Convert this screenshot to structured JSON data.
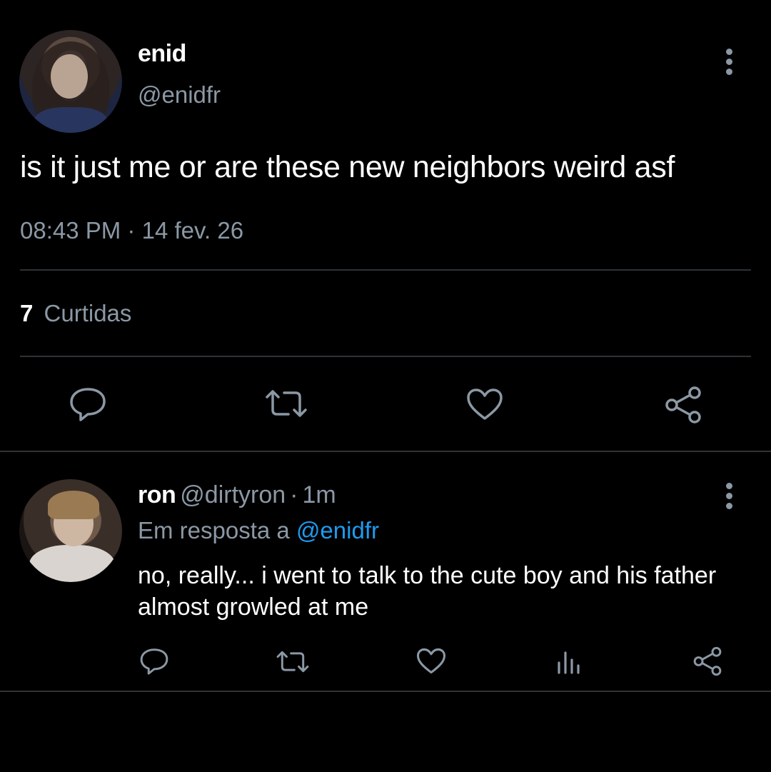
{
  "main_tweet": {
    "author": {
      "name": "enid",
      "handle": "@enidfr"
    },
    "text": "is it just me or are these new neighbors weird asf",
    "time": "08:43 PM",
    "separator": "·",
    "date": "14 fev. 26",
    "likes_count": "7",
    "likes_label": "Curtidas",
    "actions": [
      "reply-icon",
      "retweet-icon",
      "heart-icon",
      "share-icon"
    ]
  },
  "reply": {
    "author": {
      "name": "ron",
      "handle": "@dirtyron"
    },
    "separator": "·",
    "time": "1m",
    "reply_to_label": "Em resposta a",
    "reply_to_handle": "@enidfr",
    "text": "no, really... i went to talk to the cute boy and his father almost growled at me",
    "actions": [
      "reply-icon",
      "retweet-icon",
      "heart-icon",
      "analytics-icon",
      "share-icon"
    ]
  },
  "colors": {
    "background": "#000000",
    "text": "#ffffff",
    "secondary": "#8b98a5",
    "link": "#1d9bf0",
    "divider": "#2f3336"
  }
}
